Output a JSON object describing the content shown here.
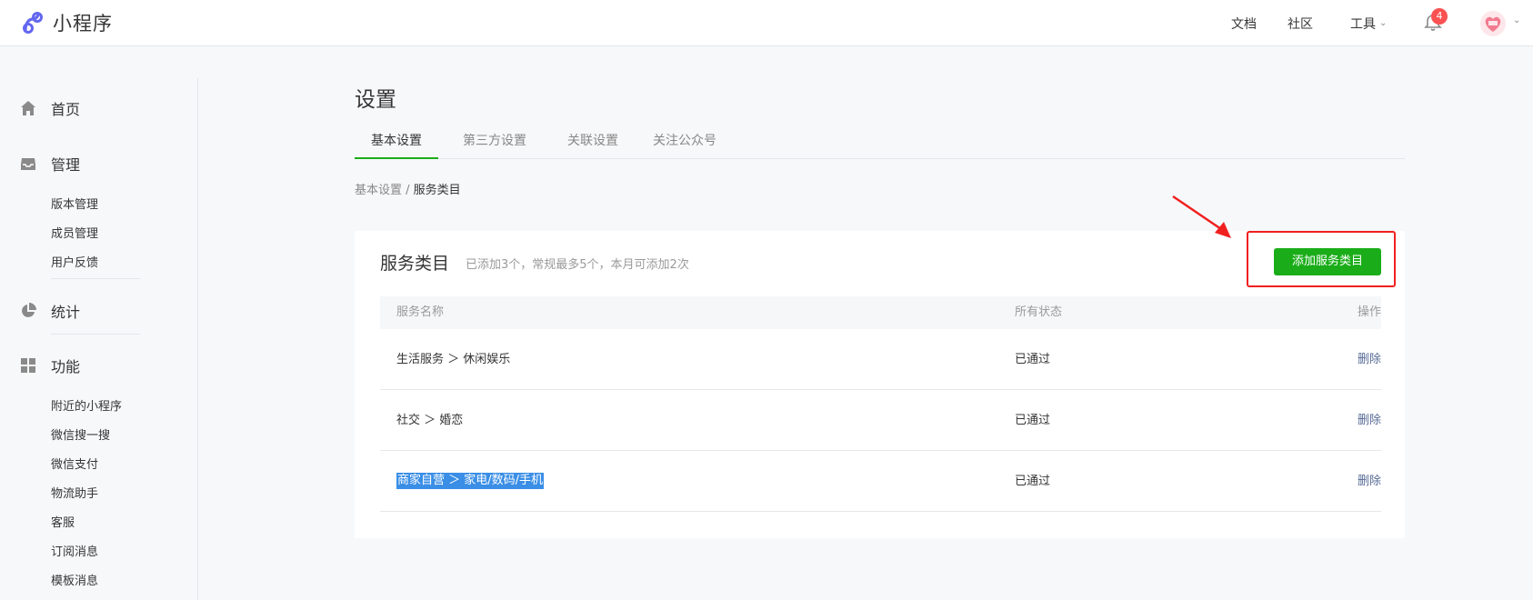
{
  "app": {
    "title": "小程序"
  },
  "topnav": {
    "docs": "文档",
    "community": "社区",
    "tools": "工具",
    "notification_count": "4"
  },
  "sidebar": {
    "home": "首页",
    "manage": "管理",
    "manage_items": [
      "版本管理",
      "成员管理",
      "用户反馈"
    ],
    "stats": "统计",
    "features": "功能",
    "feature_items": [
      "附近的小程序",
      "微信搜一搜",
      "微信支付",
      "物流助手",
      "客服",
      "订阅消息",
      "模板消息"
    ]
  },
  "page": {
    "title": "设置",
    "tabs": [
      "基本设置",
      "第三方设置",
      "关联设置",
      "关注公众号"
    ],
    "breadcrumb": {
      "parent": "基本设置",
      "sep": " / ",
      "current": "服务类目"
    }
  },
  "card": {
    "title": "服务类目",
    "desc": "已添加3个，常规最多5个，本月可添加2次",
    "add_button": "添加服务类目",
    "columns": [
      "服务名称",
      "所有状态",
      "操作"
    ],
    "rows": [
      {
        "name": "生活服务 ＞ 休闲娱乐",
        "status": "已通过",
        "action": "删除"
      },
      {
        "name": "社交 ＞ 婚恋",
        "status": "已通过",
        "action": "删除"
      },
      {
        "name": "商家自营 ＞ 家电/数码/手机",
        "status": "已通过",
        "action": "删除"
      }
    ]
  },
  "colors": {
    "accent": "#1aad19",
    "annotation": "#f0201f",
    "link": "#576b95",
    "selection": "#3a8ee6"
  },
  "icons": [
    "logo-icon",
    "bell-icon",
    "home-icon",
    "inbox-icon",
    "pie-chart-icon",
    "grid-icon",
    "chevron-down-icon",
    "annotation-arrow"
  ]
}
